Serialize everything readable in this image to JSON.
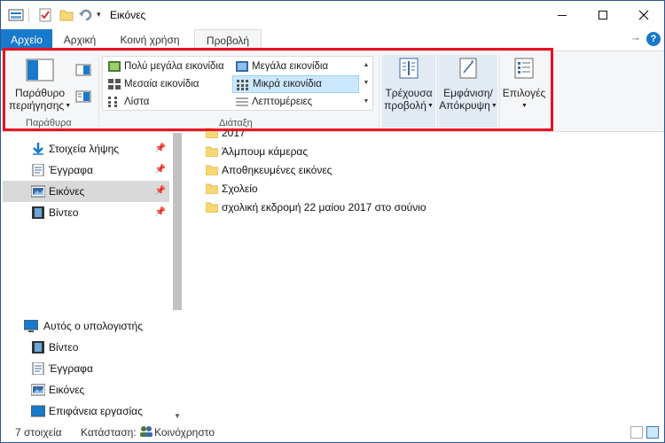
{
  "window": {
    "title": "Εικόνες"
  },
  "tabs": {
    "file": "Αρχείο",
    "home": "Αρχική",
    "share": "Κοινή χρήση",
    "view": "Προβολή"
  },
  "ribbon": {
    "panes": {
      "nav_pane_line1": "Παράθυρο",
      "nav_pane_line2": "περιήγησης",
      "group_label": "Παράθυρα"
    },
    "layout": {
      "items": [
        "Πολύ μεγάλα εικονίδια",
        "Μεγάλα εικονίδια",
        "Μεσαία εικονίδια",
        "Μικρά εικονίδια",
        "Λίστα",
        "Λεπτομέρειες"
      ],
      "selected": "Μικρά εικονίδια",
      "group_label": "Διάταξη"
    },
    "current_view_line1": "Τρέχουσα",
    "current_view_line2": "προβολή",
    "show_hide_line1": "Εμφάνιση/",
    "show_hide_line2": "Απόκρυψη",
    "options": "Επιλογές"
  },
  "nav": {
    "quick_access": [
      "Στοιχεία λήψης",
      "Έγγραφα",
      "Εικόνες",
      "Βίντεο"
    ],
    "selected": "Εικόνες",
    "this_pc": "Αυτός ο υπολογιστής",
    "pc_items": [
      "Βίντεο",
      "Έγγραφα",
      "Εικόνες",
      "Επιφάνεια εργασίας"
    ]
  },
  "files": [
    "2017",
    "Άλμπουμ κάμερας",
    "Αποθηκευμένες εικόνες",
    "Σχολείο",
    "σχολική εκδρομή 22 μαίου 2017 στο σούνιο"
  ],
  "status": {
    "count": "7 στοιχεία",
    "state_label": "Κατάσταση:",
    "state_value": "Κοινόχρηστο"
  },
  "colors": {
    "accent": "#1979ca",
    "selection": "#cce8ff",
    "highlight_frame": "#e81123",
    "folder": "#f8d775"
  }
}
